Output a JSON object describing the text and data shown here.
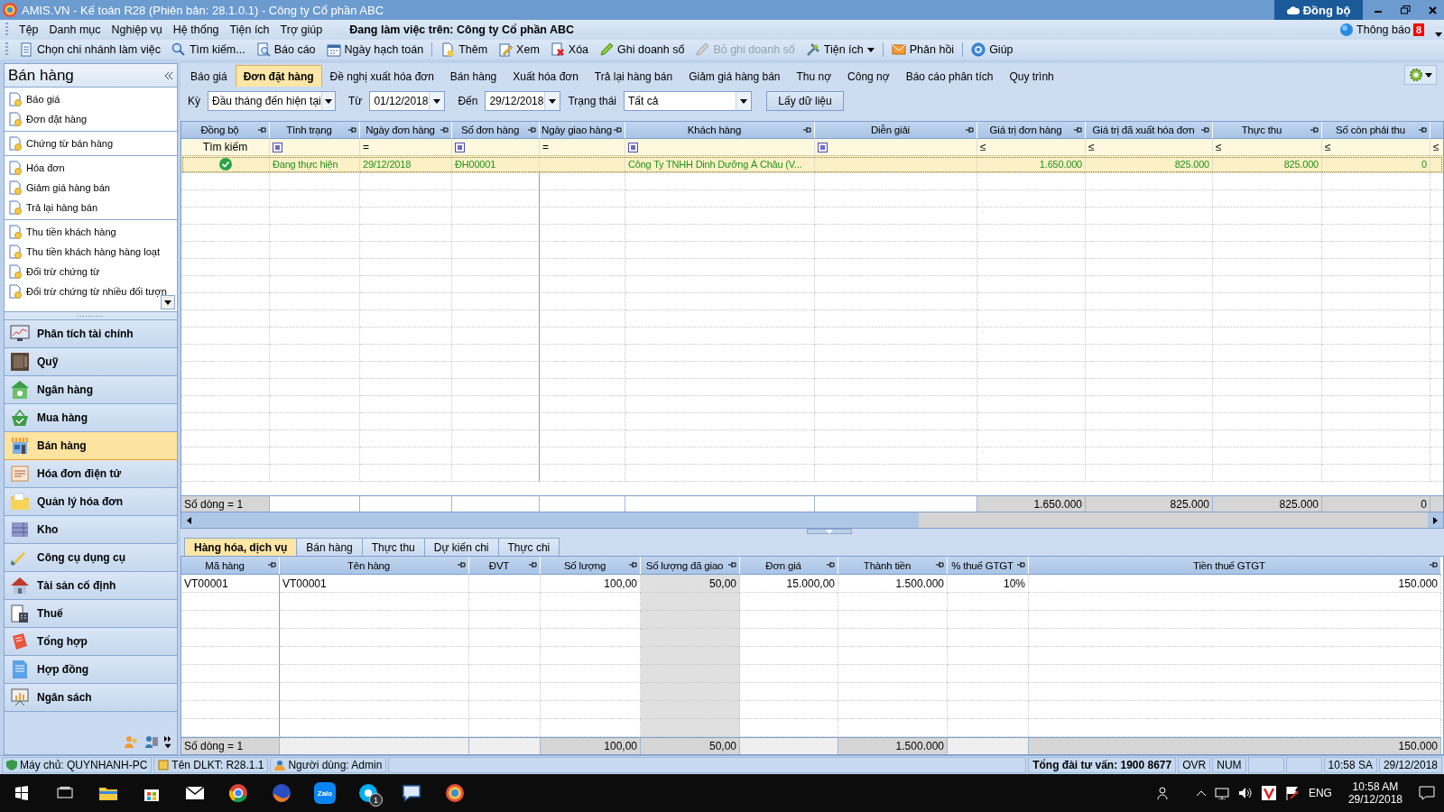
{
  "window": {
    "title": "AMIS.VN - Kế toán R28 (Phiên bản: 28.1.0.1) - Công ty Cổ phần ABC",
    "sync_button": "Đồng bộ"
  },
  "menu": [
    "Tệp",
    "Danh mục",
    "Nghiệp vụ",
    "Hệ thống",
    "Tiện ích",
    "Trợ giúp"
  ],
  "workspace": "Đang làm việc trên:  Công ty Cổ phần ABC",
  "notifications": {
    "label": "Thông báo",
    "count": "8"
  },
  "toolbar": [
    [
      {
        "label": "Chọn chi nhánh làm việc",
        "kind": "button",
        "disabled": false
      },
      {
        "label": "Tìm kiếm...",
        "kind": "button",
        "disabled": false
      },
      {
        "label": "Báo cáo",
        "kind": "button",
        "disabled": false
      },
      {
        "label": "Ngày hạch toán",
        "kind": "button",
        "disabled": false
      }
    ],
    [
      {
        "label": "Thêm",
        "kind": "button",
        "disabled": false
      },
      {
        "label": "Xem",
        "kind": "button",
        "disabled": false
      },
      {
        "label": "Xóa",
        "kind": "button",
        "disabled": false
      },
      {
        "label": "Ghi doanh số",
        "kind": "button",
        "disabled": false
      },
      {
        "label": "Bỏ ghi doanh số",
        "kind": "button",
        "disabled": true
      },
      {
        "label": "Tiện ích",
        "kind": "dropdown",
        "disabled": false
      }
    ],
    [
      {
        "label": "Phản hồi",
        "kind": "button",
        "disabled": false
      }
    ],
    [
      {
        "label": "Giúp",
        "kind": "button",
        "disabled": false
      }
    ]
  ],
  "sidebar": {
    "title": "Bán hàng",
    "groups": [
      [
        "Báo giá",
        "Đơn đặt hàng"
      ],
      [
        "Chứng từ bán hàng"
      ],
      [
        "Hóa đơn",
        "Giảm giá hàng bán",
        "Trả lại hàng bán"
      ],
      [
        "Thu tiền khách hàng",
        "Thu tiền khách hàng hàng loạt",
        "Đối trừ chứng từ",
        "Đối trừ chứng từ nhiều đối tượn"
      ]
    ],
    "modules": [
      {
        "label": "Phân tích tài chính",
        "selected": false
      },
      {
        "label": "Quỹ",
        "selected": false
      },
      {
        "label": "Ngân hàng",
        "selected": false
      },
      {
        "label": "Mua hàng",
        "selected": false
      },
      {
        "label": "Bán hàng",
        "selected": true
      },
      {
        "label": "Hóa đơn điện tử",
        "selected": false
      },
      {
        "label": "Quản lý hóa đơn",
        "selected": false
      },
      {
        "label": "Kho",
        "selected": false
      },
      {
        "label": "Công cụ dụng cụ",
        "selected": false
      },
      {
        "label": "Tài sản cố định",
        "selected": false
      },
      {
        "label": "Thuế",
        "selected": false
      },
      {
        "label": "Tổng hợp",
        "selected": false
      },
      {
        "label": "Hợp đồng",
        "selected": false
      },
      {
        "label": "Ngân sách",
        "selected": false
      }
    ]
  },
  "tabs": [
    {
      "label": "Báo giá",
      "selected": false
    },
    {
      "label": "Đơn đặt hàng",
      "selected": true
    },
    {
      "label": "Đề nghị xuất hóa đơn",
      "selected": false
    },
    {
      "label": "Bán hàng",
      "selected": false
    },
    {
      "label": "Xuất hóa đơn",
      "selected": false
    },
    {
      "label": "Trả lại hàng bán",
      "selected": false
    },
    {
      "label": "Giảm giá hàng bán",
      "selected": false
    },
    {
      "label": "Thu nợ",
      "selected": false
    },
    {
      "label": "Công nợ",
      "selected": false
    },
    {
      "label": "Báo cáo phân tích",
      "selected": false
    },
    {
      "label": "Quy trình",
      "selected": false
    }
  ],
  "filter": {
    "period_label": "Kỳ",
    "period": "Đầu tháng đến hiện tại",
    "from_label": "Từ",
    "from": "01/12/2018",
    "to_label": "Đến",
    "to": "29/12/2018",
    "status_label": "Trạng thái",
    "status": "Tất cả",
    "button": "Lấy dữ liệu"
  },
  "orders": {
    "columns": [
      "Đồng bộ",
      "Tình trạng",
      "Ngày đơn hàng",
      "Số đơn hàng",
      "Ngày giao hàng",
      "Khách hàng",
      "Diễn giải",
      "Giá trị đơn hàng",
      "Giá trị đã xuất hóa đơn",
      "Thực thu",
      "Số còn phải thu"
    ],
    "filter_row": [
      {
        "kind": "label",
        "text": "Tìm kiếm"
      },
      {
        "kind": "contains"
      },
      {
        "kind": "operator",
        "text": "="
      },
      {
        "kind": "contains"
      },
      {
        "kind": "operator",
        "text": "="
      },
      {
        "kind": "contains"
      },
      {
        "kind": "contains"
      },
      {
        "kind": "operator",
        "text": "≤"
      },
      {
        "kind": "operator",
        "text": "≤"
      },
      {
        "kind": "operator",
        "text": "≤"
      },
      {
        "kind": "operator",
        "text": "≤"
      },
      {
        "kind": "operator",
        "text": "≤"
      }
    ],
    "rows": [
      {
        "selected": true,
        "synced": true,
        "cells": [
          null,
          "Đang thực hiện",
          "29/12/2018",
          "ĐH00001",
          null,
          "Công Ty TNHH Dinh Dưỡng Á Châu (V...",
          null,
          "1.650.000",
          "825.000",
          "825.000",
          "0"
        ]
      }
    ],
    "footer": {
      "count": "Số dòng = 1",
      "order_value": "1.650.000",
      "invoiced_value": "825.000",
      "collected": "825.000",
      "remaining": "0"
    }
  },
  "detail_tabs": [
    {
      "label": "Hàng hóa, dịch vụ",
      "selected": true
    },
    {
      "label": "Bán hàng",
      "selected": false
    },
    {
      "label": "Thực thu",
      "selected": false
    },
    {
      "label": "Dự kiến chi",
      "selected": false
    },
    {
      "label": "Thực chi",
      "selected": false
    }
  ],
  "details": {
    "columns": [
      "Mã hàng",
      "Tên hàng",
      "ĐVT",
      "Số lượng",
      "Số lượng đã giao",
      "Đơn giá",
      "Thành tiền",
      "% thuế GTGT",
      "Tiền thuế GTGT"
    ],
    "rows": [
      {
        "cells": [
          "VT00001",
          "VT00001",
          null,
          "100,00",
          "50,00",
          "15.000,00",
          "1.500.000",
          "10%",
          "150.000"
        ]
      }
    ],
    "footer": {
      "count": "Số dòng = 1",
      "quantity": "100,00",
      "delivered": "50,00",
      "amount": "1.500.000",
      "vat_amount": "150.000"
    }
  },
  "status_bar": {
    "server": "Máy chủ: QUYNHANH-PC",
    "database": "Tên DLKT: R28.1.1",
    "user": "Người dùng: Admin",
    "hotline": "Tổng đài tư vấn: 1900 8677",
    "keys": [
      "OVR",
      "NUM"
    ],
    "time": "10:58 SA",
    "date": "29/12/2018"
  },
  "taskbar": {
    "zalo": "Zalo",
    "skype_badge": "1",
    "language": "ENG",
    "time": "10:58 AM",
    "date": "29/12/2018"
  }
}
